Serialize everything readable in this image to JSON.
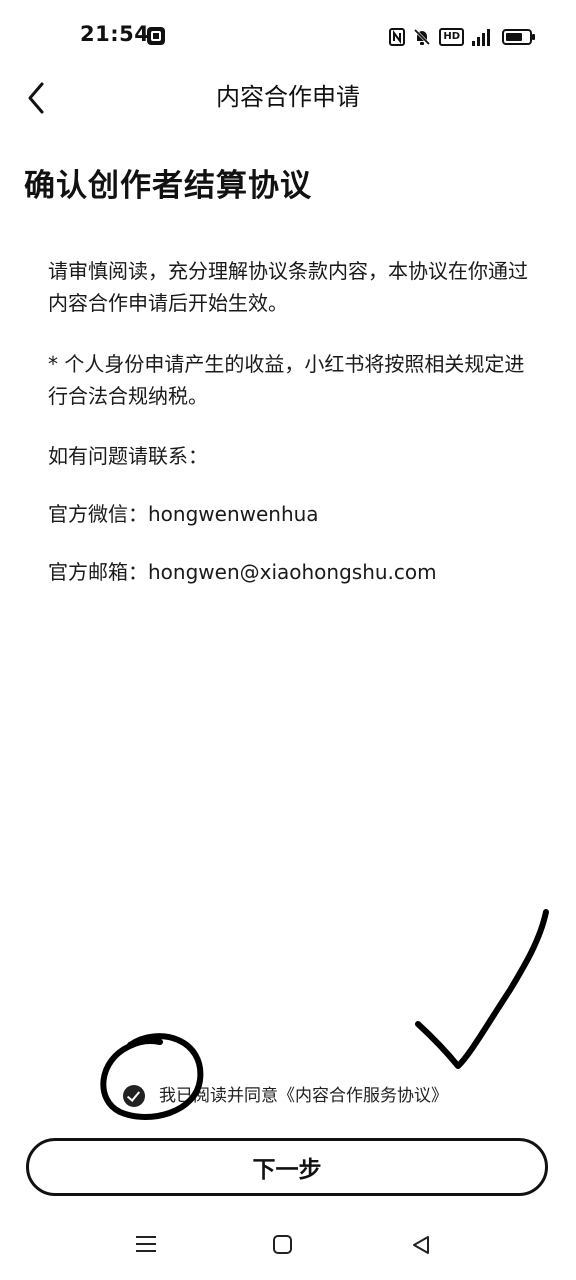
{
  "status_bar": {
    "time": "21:54",
    "icons": [
      "app-notification-icon",
      "nfc-icon",
      "mute-icon",
      "hd-icon",
      "signal-icon",
      "battery-icon"
    ],
    "hd_label": "HD"
  },
  "nav": {
    "back_icon": "chevron-left-icon",
    "title": "内容合作申请"
  },
  "content": {
    "heading": "确认创作者结算协议",
    "paragraph_1": "请审慎阅读，充分理解协议条款内容，本协议在你通过内容合作申请后开始生效。",
    "paragraph_2": "* 个人身份申请产生的收益，小红书将按照相关规定进行合法合规纳税。",
    "contact_intro": "如有问题请联系：",
    "wechat": "官方微信：hongwenwenhua",
    "email": "官方邮箱：hongwen@xiaohongshu.com"
  },
  "agreement": {
    "checked": true,
    "text": "我已阅读并同意",
    "link": "《内容合作服务协议》"
  },
  "next_button": {
    "label": "下一步"
  },
  "system_nav": {
    "icons": [
      "menu-icon",
      "home-icon",
      "back-triangle-icon"
    ]
  },
  "colors": {
    "text": "#111111",
    "background": "#ffffff",
    "annotation_ink": "#000000"
  }
}
